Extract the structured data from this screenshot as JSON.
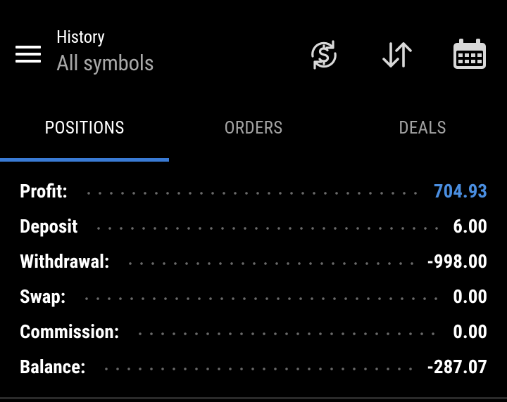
{
  "header": {
    "title": "History",
    "subtitle": "All symbols",
    "icons": {
      "menu": "hamburger-menu-icon",
      "currency": "currency-exchange-icon",
      "sort": "sort-arrows-icon",
      "calendar": "calendar-icon"
    }
  },
  "tabs": [
    {
      "label": "POSITIONS",
      "active": true
    },
    {
      "label": "ORDERS",
      "active": false
    },
    {
      "label": "DEALS",
      "active": false
    }
  ],
  "summary": [
    {
      "label": "Profit:",
      "value": "704.93"
    },
    {
      "label": "Deposit",
      "value": "6.00"
    },
    {
      "label": "Withdrawal:",
      "value": "-998.00"
    },
    {
      "label": "Swap:",
      "value": "0.00"
    },
    {
      "label": "Commission:",
      "value": "0.00"
    },
    {
      "label": "Balance:",
      "value": "-287.07"
    }
  ],
  "colors": {
    "background": "#000000",
    "accent": "#3a7bd5",
    "profit": "#4a8ee0",
    "inactive_text": "#a3a3a3",
    "dots": "#6a6a6a"
  }
}
